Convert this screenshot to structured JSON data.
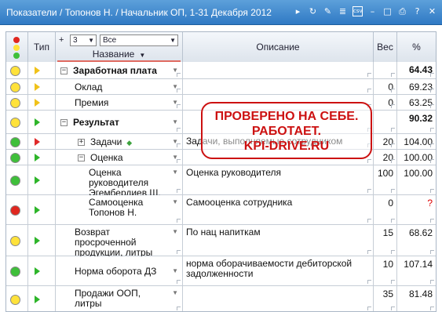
{
  "window": {
    "title": "Показатели / Топонов Н. / Начальник ОП, 1-31 Декабря 2012"
  },
  "header": {
    "type_label": "Тип",
    "plus_sign": "+",
    "level_value": "3",
    "filter_value": "Все",
    "name_label": "Название",
    "desc_label": "Описание",
    "weight_label": "Вес",
    "percent_label": "%"
  },
  "rows": [
    {
      "light": "yellow",
      "arrow": "yellow",
      "expand": "minus",
      "indent": 0,
      "name_lines": [
        "Заработная плата"
      ],
      "bold": true,
      "desc_lines": [],
      "weight": "",
      "percent": "64.43"
    },
    {
      "light": "yellow",
      "arrow": "yellow",
      "expand": "",
      "indent": 0,
      "name_lines": [
        "Оклад"
      ],
      "bold": false,
      "desc_lines": [],
      "weight": "0",
      "percent": "69.23"
    },
    {
      "light": "yellow",
      "arrow": "yellow",
      "expand": "",
      "indent": 0,
      "name_lines": [
        "Премия"
      ],
      "bold": false,
      "desc_lines": [],
      "weight": "0",
      "percent": "63.25"
    },
    {
      "light": "yellow",
      "arrow": "green",
      "expand": "minus",
      "indent": 0,
      "name_lines": [
        "Результат"
      ],
      "bold": true,
      "desc_lines": [],
      "weight": "",
      "percent": "90.32"
    },
    {
      "light": "green",
      "arrow": "red",
      "expand": "plus",
      "indent": 1,
      "name_lines": [
        "Задачи"
      ],
      "bold": false,
      "diamond": true,
      "desc_lines": [
        "Задачи, выполняемые сотрудником"
      ],
      "weight": "20",
      "percent": "104.00"
    },
    {
      "light": "green",
      "arrow": "green",
      "expand": "minus",
      "indent": 1,
      "name_lines": [
        "Оценка"
      ],
      "bold": false,
      "desc_lines": [],
      "weight": "20",
      "percent": "100.00"
    },
    {
      "light": "green",
      "arrow": "green",
      "expand": "",
      "indent": 2,
      "name_lines": [
        "Оценка",
        "руководителя",
        "Эгембердиев Ш."
      ],
      "bold": false,
      "desc_lines": [
        "Оценка руководителя"
      ],
      "weight": "100",
      "percent": "100.00"
    },
    {
      "light": "red",
      "arrow": "green",
      "expand": "",
      "indent": 2,
      "name_lines": [
        "Самооценка",
        "Топонов Н."
      ],
      "bold": false,
      "desc_lines": [
        "Самооценка сотрудника"
      ],
      "weight": "0",
      "percent": "?"
    },
    {
      "light": "yellow",
      "arrow": "green",
      "expand": "",
      "indent": 0,
      "name_lines": [
        "Возврат",
        "просроченной",
        "продукции, литры"
      ],
      "bold": false,
      "desc_lines": [
        "По нац напиткам"
      ],
      "weight": "15",
      "percent": "68.62"
    },
    {
      "light": "green",
      "arrow": "green",
      "expand": "",
      "indent": 0,
      "name_lines": [
        "Норма оборота ДЗ"
      ],
      "bold": false,
      "desc_lines": [
        "норма оборачиваемости дебиторской",
        "задолженности"
      ],
      "weight": "10",
      "percent": "107.14"
    },
    {
      "light": "yellow",
      "arrow": "green",
      "expand": "",
      "indent": 0,
      "name_lines": [
        "Продажи ООП,",
        "литры"
      ],
      "bold": false,
      "desc_lines": [],
      "weight": "35",
      "percent": "81.48"
    }
  ],
  "watermark": {
    "lines": [
      "ПРОВЕРЕНО НА СЕБЕ.",
      "РАБОТАЕТ.",
      "KPI-DRIVE.RU"
    ]
  },
  "colors": {
    "titlebar": "#3a85cf",
    "yellow": "#ffe23a",
    "green": "#3fbf3a",
    "red": "#e0271f",
    "arrow_yellow": "#f0c21a",
    "arrow_green": "#2eb52a",
    "arrow_red": "#e02a2a",
    "stamp": "#cc1111"
  }
}
